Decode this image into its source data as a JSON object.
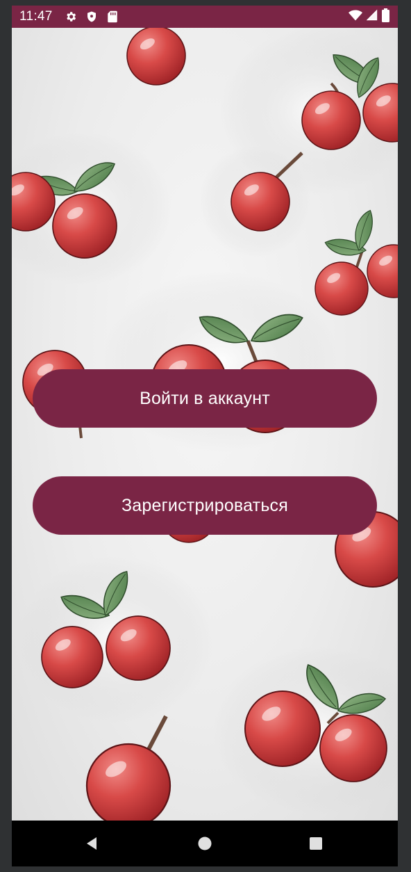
{
  "theme": {
    "primary_color": "#7a2545",
    "status_icon_color": "#ffffff",
    "nav_icon_color": "#e0e0e0"
  },
  "status_bar": {
    "time": "11:47",
    "left_icons": [
      "gear-icon",
      "shield-icon",
      "sd-card-icon"
    ],
    "right_icons": [
      "wifi-icon",
      "cell-signal-icon",
      "battery-icon"
    ]
  },
  "background": {
    "image": "cherry-pattern-wallpaper"
  },
  "auth": {
    "login_label": "Войти в аккаунт",
    "register_label": "Зарегистрироваться"
  },
  "nav_bar": {
    "icons": [
      "back-icon",
      "home-icon",
      "recents-icon"
    ]
  }
}
